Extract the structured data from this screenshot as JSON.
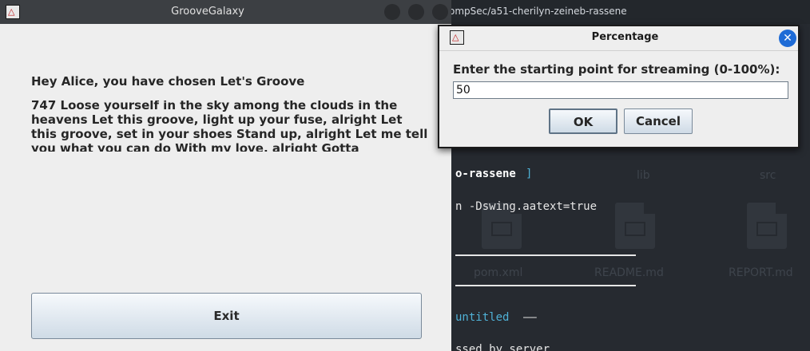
{
  "app": {
    "title": "GrooveGalaxy",
    "greeting": "Hey Alice, you have chosen Let's Groove",
    "lyrics": "747 Loose yourself in the sky among the clouds in the heavens Let this groove, light up your fuse, alright Let this groove, set in your shoes Stand up, alright Let me tell you what you can do With my love, alright Gotta",
    "exit_label": "Exit"
  },
  "dialog": {
    "title": "Percentage",
    "prompt": "Enter the starting point for streaming (0-100%):",
    "input_value": "50",
    "ok_label": "OK",
    "cancel_label": "Cancel",
    "close_icon": "✕"
  },
  "background": {
    "window_title": "ompSec/a51-cherilyn-zeineb-rassene",
    "path_fragment": "o-rassene",
    "path_bracket": "]",
    "command": "n -Dswing.aatext=true",
    "untitled": "untitled",
    "untitled_dash": "——",
    "last_line": "ssed by server",
    "folders": [
      "lib",
      "src"
    ],
    "files": [
      "pom.xml",
      "README.md",
      "REPORT.md"
    ]
  },
  "colors": {
    "close_button": "#1e6bd6",
    "terminal_bold": "#ffffff",
    "terminal_cyan": "#4fb1d6"
  }
}
